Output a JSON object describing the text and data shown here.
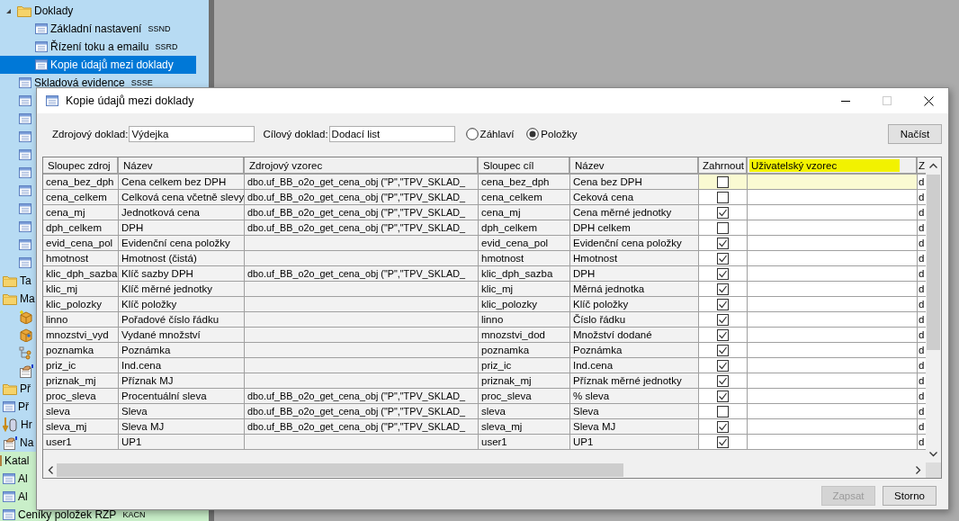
{
  "tree": [
    {
      "items": [
        {
          "kind": "folder",
          "label": "Doklady",
          "expanded": true,
          "selected": false,
          "children": [
            {
              "kind": "table",
              "label": "Základní nastavení",
              "code": "SSND",
              "selected": false
            },
            {
              "kind": "table",
              "label": "Řízení toku a emailu",
              "code": "SSRD",
              "selected": false
            },
            {
              "kind": "table",
              "label": "Kopie údajů mezi doklady",
              "selected": true
            }
          ]
        },
        {
          "kind": "table",
          "label": "Skladová evidence",
          "code": "SSSE",
          "selected": false
        },
        {
          "kind": "table",
          "selected": false
        },
        {
          "kind": "table",
          "selected": false
        },
        {
          "kind": "table",
          "selected": false
        },
        {
          "kind": "table",
          "selected": false
        },
        {
          "kind": "table",
          "selected": false
        },
        {
          "kind": "table",
          "selected": false
        },
        {
          "kind": "table",
          "selected": false
        },
        {
          "kind": "table",
          "selected": false
        },
        {
          "kind": "table",
          "selected": false
        },
        {
          "kind": "table",
          "selected": false
        }
      ]
    },
    {
      "items": [
        {
          "kind": "folder",
          "label": "Ta",
          "selected": false
        },
        {
          "kind": "folder",
          "label": "Ma",
          "selected": false,
          "children": [
            {
              "kind": "box-plus",
              "selected": false
            },
            {
              "kind": "box",
              "selected": false
            },
            {
              "kind": "diagram",
              "selected": false
            },
            {
              "kind": "hand",
              "selected": false
            }
          ]
        },
        {
          "kind": "folder",
          "label": "Př",
          "selected": false
        },
        {
          "kind": "table",
          "label": "Př",
          "selected": false
        },
        {
          "kind": "db",
          "label": "Hr",
          "selected": false
        },
        {
          "kind": "hand",
          "label": "Na",
          "selected": false
        }
      ]
    },
    {
      "items": [
        {
          "kind": "plain",
          "label": "Katal",
          "selected": false,
          "children": [
            {
              "kind": "table",
              "label": "Al",
              "selected": false
            },
            {
              "kind": "table",
              "label": "Al",
              "selected": false
            },
            {
              "kind": "table",
              "label": "Ceníky položek RZP",
              "code": "KACN",
              "selected": false
            }
          ]
        }
      ]
    }
  ],
  "dialog": {
    "title": "Kopie údajů mezi doklady",
    "source": {
      "label": "Zdrojový doklad:",
      "value": "Výdejka"
    },
    "target": {
      "label": "Cílový doklad:",
      "value": "Dodací list"
    },
    "scope": [
      {
        "label": "Záhlaví",
        "selected": false
      },
      {
        "label": "Položky",
        "selected": true
      }
    ],
    "load_button": "Načíst",
    "columns": [
      {
        "label": "Sloupec zdroj",
        "highlighted": false
      },
      {
        "label": "Název",
        "highlighted": false
      },
      {
        "label": "Zdrojový vzorec",
        "highlighted": false
      },
      {
        "label": "Sloupec cíl",
        "highlighted": false
      },
      {
        "label": "Název",
        "highlighted": false
      },
      {
        "label": "Zahrnout",
        "highlighted": false
      },
      {
        "label": "Uživatelský vzorec",
        "highlighted": true
      },
      {
        "label": "Z",
        "highlighted": false
      }
    ],
    "rows": [
      {
        "source_column": "cena_bez_dph",
        "source_name": "Cena celkem bez DPH",
        "source_formula": "dbo.uf_BB_o2o_get_cena_obj (\"P\",\"TPV_SKLAD_",
        "target_column": "cena_bez_dph",
        "target_name": "Cena bez DPH",
        "include": false,
        "column_8": "d",
        "selected": true
      },
      {
        "source_column": "cena_celkem",
        "source_name": "Celková cena včetně slevy",
        "source_formula": "dbo.uf_BB_o2o_get_cena_obj (\"P\",\"TPV_SKLAD_",
        "target_column": "cena_celkem",
        "target_name": "Ceková cena",
        "include": false,
        "column_8": "d",
        "selected": false
      },
      {
        "source_column": "cena_mj",
        "source_name": "Jednotková cena",
        "source_formula": "dbo.uf_BB_o2o_get_cena_obj (\"P\",\"TPV_SKLAD_",
        "target_column": "cena_mj",
        "target_name": "Cena měrné jednotky",
        "include": true,
        "column_8": "d",
        "selected": false
      },
      {
        "source_column": "dph_celkem",
        "source_name": "DPH",
        "source_formula": "dbo.uf_BB_o2o_get_cena_obj (\"P\",\"TPV_SKLAD_",
        "target_column": "dph_celkem",
        "target_name": "DPH celkem",
        "include": false,
        "column_8": "d",
        "selected": false
      },
      {
        "source_column": "evid_cena_pol",
        "source_name": "Evidenční cena položky",
        "target_column": "evid_cena_pol",
        "target_name": "Evidenční cena položky",
        "include": true,
        "column_8": "d",
        "selected": false
      },
      {
        "source_column": "hmotnost",
        "source_name": "Hmotnost (čistá)",
        "target_column": "hmotnost",
        "target_name": "Hmotnost",
        "include": true,
        "column_8": "d",
        "selected": false
      },
      {
        "source_column": "klic_dph_sazba",
        "source_name": "Klíč sazby DPH",
        "source_formula": "dbo.uf_BB_o2o_get_cena_obj (\"P\",\"TPV_SKLAD_",
        "target_column": "klic_dph_sazba",
        "target_name": "DPH",
        "include": true,
        "column_8": "d",
        "selected": false
      },
      {
        "source_column": "klic_mj",
        "source_name": "Klíč měrné jednotky",
        "target_column": "klic_mj",
        "target_name": "Měrná jednotka",
        "include": true,
        "column_8": "d",
        "selected": false
      },
      {
        "source_column": "klic_polozky",
        "source_name": "Klíč položky",
        "target_column": "klic_polozky",
        "target_name": "Klíč položky",
        "include": true,
        "column_8": "d",
        "selected": false
      },
      {
        "source_column": "linno",
        "source_name": "Pořadové číslo řádku",
        "target_column": "linno",
        "target_name": "Číslo řádku",
        "include": true,
        "column_8": "d",
        "selected": false
      },
      {
        "source_column": "mnozstvi_vyd",
        "source_name": "Vydané množství",
        "target_column": "mnozstvi_dod",
        "target_name": "Množství dodané",
        "include": true,
        "column_8": "d",
        "selected": false
      },
      {
        "source_column": "poznamka",
        "source_name": "Poznámka",
        "target_column": "poznamka",
        "target_name": "Poznámka",
        "include": true,
        "column_8": "d",
        "selected": false
      },
      {
        "source_column": "priz_ic",
        "source_name": "Ind.cena",
        "target_column": "priz_ic",
        "target_name": "Ind.cena",
        "include": true,
        "column_8": "d",
        "selected": false
      },
      {
        "source_column": "priznak_mj",
        "source_name": "Příznak MJ",
        "target_column": "priznak_mj",
        "target_name": "Příznak měrné jednotky",
        "include": true,
        "column_8": "d",
        "selected": false
      },
      {
        "source_column": "proc_sleva",
        "source_name": "Procentuální sleva",
        "source_formula": "dbo.uf_BB_o2o_get_cena_obj (\"P\",\"TPV_SKLAD_",
        "target_column": "proc_sleva",
        "target_name": "% sleva",
        "include": true,
        "column_8": "d",
        "selected": false
      },
      {
        "source_column": "sleva",
        "source_name": "Sleva",
        "source_formula": "dbo.uf_BB_o2o_get_cena_obj (\"P\",\"TPV_SKLAD_",
        "target_column": "sleva",
        "target_name": "Sleva",
        "include": false,
        "column_8": "d",
        "selected": false
      },
      {
        "source_column": "sleva_mj",
        "source_name": "Sleva MJ",
        "source_formula": "dbo.uf_BB_o2o_get_cena_obj (\"P\",\"TPV_SKLAD_",
        "target_column": "sleva_mj",
        "target_name": "Sleva MJ",
        "include": true,
        "column_8": "d",
        "selected": false
      },
      {
        "source_column": "user1",
        "source_name": "UP1",
        "target_column": "user1",
        "target_name": "UP1",
        "include": true,
        "column_8": "d",
        "selected": false
      }
    ],
    "buttons": [
      {
        "label": "Zapsat",
        "disabled": true
      },
      {
        "label": "Storno",
        "disabled": false
      }
    ]
  }
}
